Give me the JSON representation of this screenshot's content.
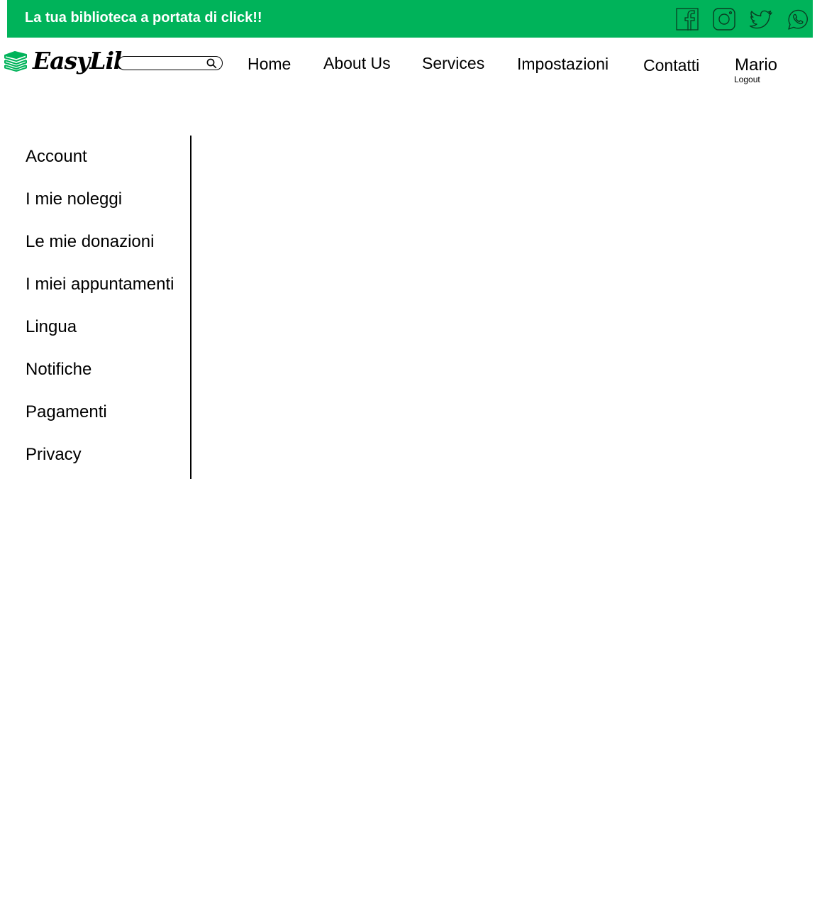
{
  "topbar": {
    "tagline": "La tua biblioteca a portata di click!!",
    "background_color": "#00b35a",
    "social_icons": [
      "facebook-icon",
      "instagram-icon",
      "twitter-icon",
      "whatsapp-icon"
    ]
  },
  "header": {
    "logo_text": "EasyLib",
    "logo_icon": "books-icon",
    "logo_icon_color": "#00b35a",
    "search": {
      "placeholder": "",
      "value": "",
      "icon": "search-icon"
    },
    "nav": [
      "Home",
      "About Us",
      "Services",
      "Impostazioni",
      "Contatti"
    ],
    "user": {
      "name": "Mario",
      "logout_label": "Logout"
    }
  },
  "sidebar": {
    "items": [
      "Account",
      "I mie noleggi",
      "Le mie donazioni",
      "I miei appuntamenti",
      "Lingua",
      "Notifiche",
      "Pagamenti",
      "Privacy"
    ]
  }
}
